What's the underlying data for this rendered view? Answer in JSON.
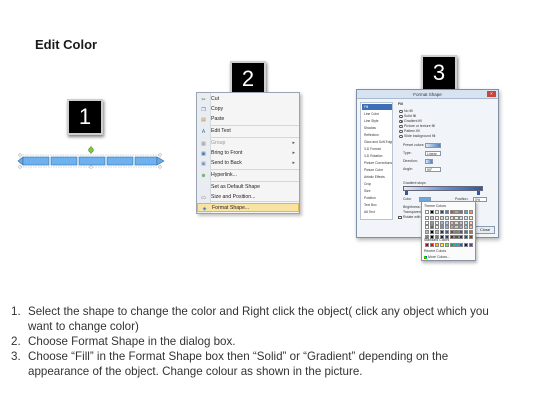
{
  "page": {
    "title": "Edit Color"
  },
  "badges": [
    "1",
    "2",
    "3"
  ],
  "context_menu": {
    "items": [
      {
        "label": "Cut",
        "icon": "scissors-icon",
        "glyph": "✂",
        "color": "#555555"
      },
      {
        "label": "Copy",
        "icon": "copy-icon",
        "glyph": "❐",
        "color": "#3a6fb5"
      },
      {
        "label": "Paste",
        "icon": "paste-icon",
        "glyph": "▤",
        "color": "#b08a3a"
      },
      {
        "label": "Edit Text",
        "icon": "edit-text-icon",
        "glyph": "A",
        "color": "#3a6fb5"
      },
      {
        "label": "Group",
        "icon": "group-icon",
        "glyph": "▦",
        "color": "#999999",
        "submenu": true,
        "disabled": true
      },
      {
        "label": "Bring to Front",
        "icon": "bring-to-front-icon",
        "glyph": "▣",
        "color": "#3a6fb5",
        "submenu": true
      },
      {
        "label": "Send to Back",
        "icon": "send-to-back-icon",
        "glyph": "▣",
        "color": "#6a8fc8",
        "submenu": true
      },
      {
        "label": "Hyperlink...",
        "icon": "hyperlink-icon",
        "glyph": "⊕",
        "color": "#2e7d32"
      },
      {
        "label": "Set as Default Shape",
        "icon": "",
        "glyph": "",
        "color": "#555555"
      },
      {
        "label": "Size and Position...",
        "icon": "size-position-icon",
        "glyph": "▭",
        "color": "#555555"
      },
      {
        "label": "Format Shape...",
        "icon": "format-shape-icon",
        "glyph": "◈",
        "color": "#3a6fb5",
        "highlighted": true
      }
    ]
  },
  "dialog": {
    "title": "Format Shape",
    "close_glyph": "×",
    "nav": [
      "Fill",
      "Line Color",
      "Line Style",
      "Shadow",
      "Reflection",
      "Glow and Soft Edges",
      "3-D Format",
      "3-D Rotation",
      "Picture Corrections",
      "Picture Color",
      "Artistic Effects",
      "Crop",
      "Size",
      "Position",
      "Text Box",
      "Alt Text"
    ],
    "section": "Fill",
    "fill_options": [
      "No fill",
      "Solid fill",
      "Gradient fill",
      "Picture or texture fill",
      "Pattern fill",
      "Slide background fill"
    ],
    "fill_selected": 2,
    "fields": [
      {
        "label": "Preset colors:",
        "value": ""
      },
      {
        "label": "Type:",
        "value": "Linear"
      },
      {
        "label": "Direction:",
        "value": ""
      },
      {
        "label": "Angle:",
        "value": "90°"
      }
    ],
    "gradient_label": "Gradient stops",
    "color_label": "Color",
    "position_label": "Position:",
    "position_value": "0%",
    "brightness_label": "Brightness:",
    "transparency_label": "Transparency:",
    "rotate_label": "Rotate with shape",
    "close_label": "Close"
  },
  "color_picker": {
    "theme_label": "Theme Colors",
    "standard_label": "Standard Colors",
    "recent_label": "Recent Colors",
    "more_label": "More Colors...",
    "theme_colors": [
      "#ffffff",
      "#000000",
      "#eeece1",
      "#1f497d",
      "#4f81bd",
      "#c0504d",
      "#9bbb59",
      "#8064a2",
      "#4bacc6",
      "#f79646"
    ],
    "standard_colors": [
      "#c00000",
      "#ff0000",
      "#ffc000",
      "#ffff00",
      "#92d050",
      "#00b050",
      "#00b0f0",
      "#0070c0",
      "#002060",
      "#7030a0"
    ]
  },
  "instructions": [
    {
      "num": "1.",
      "lines": [
        "Select the shape to change the color and Right click the object( click any object which you",
        "want to change color)"
      ]
    },
    {
      "num": "2.",
      "lines": [
        "Choose Format Shape in the dialog box."
      ]
    },
    {
      "num": "3.",
      "lines": [
        "Choose “Fill” in the Format Shape box then “Solid” or “Gradient” depending on the",
        "appearance of the object. Change colour as shown in the picture."
      ]
    }
  ]
}
